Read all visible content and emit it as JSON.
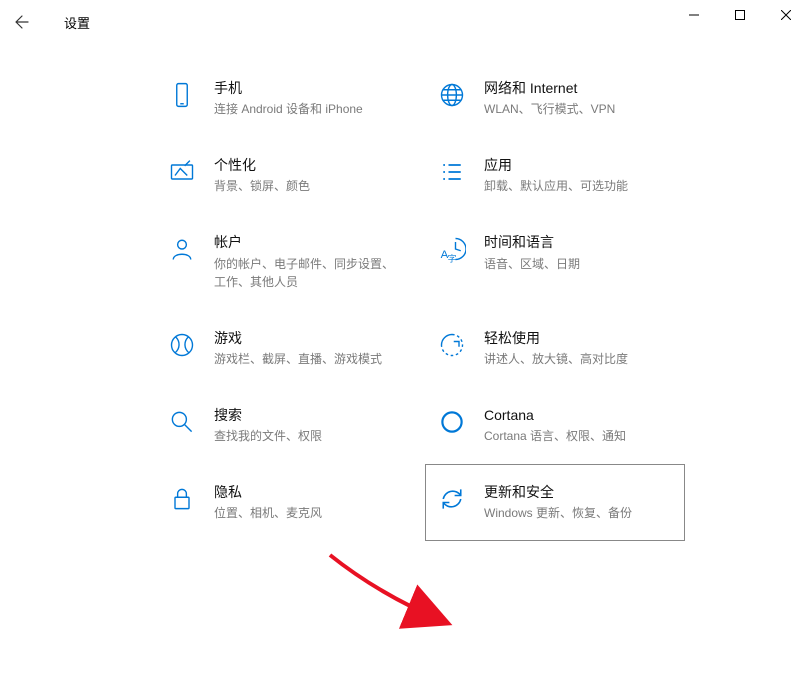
{
  "window": {
    "title": "设置"
  },
  "tiles": [
    {
      "key": "phone",
      "title": "手机",
      "desc": "连接 Android 设备和 iPhone"
    },
    {
      "key": "network",
      "title": "网络和 Internet",
      "desc": "WLAN、飞行模式、VPN"
    },
    {
      "key": "personal",
      "title": "个性化",
      "desc": "背景、锁屏、颜色"
    },
    {
      "key": "apps",
      "title": "应用",
      "desc": "卸载、默认应用、可选功能"
    },
    {
      "key": "accounts",
      "title": "帐户",
      "desc": "你的帐户、电子邮件、同步设置、工作、其他人员"
    },
    {
      "key": "time",
      "title": "时间和语言",
      "desc": "语音、区域、日期"
    },
    {
      "key": "gaming",
      "title": "游戏",
      "desc": "游戏栏、截屏、直播、游戏模式"
    },
    {
      "key": "ease",
      "title": "轻松使用",
      "desc": "讲述人、放大镜、高对比度"
    },
    {
      "key": "search",
      "title": "搜索",
      "desc": "查找我的文件、权限"
    },
    {
      "key": "cortana",
      "title": "Cortana",
      "desc": "Cortana 语言、权限、通知"
    },
    {
      "key": "privacy",
      "title": "隐私",
      "desc": "位置、相机、麦克风"
    },
    {
      "key": "update",
      "title": "更新和安全",
      "desc": "Windows 更新、恢复、备份"
    }
  ],
  "highlighted_key": "update"
}
